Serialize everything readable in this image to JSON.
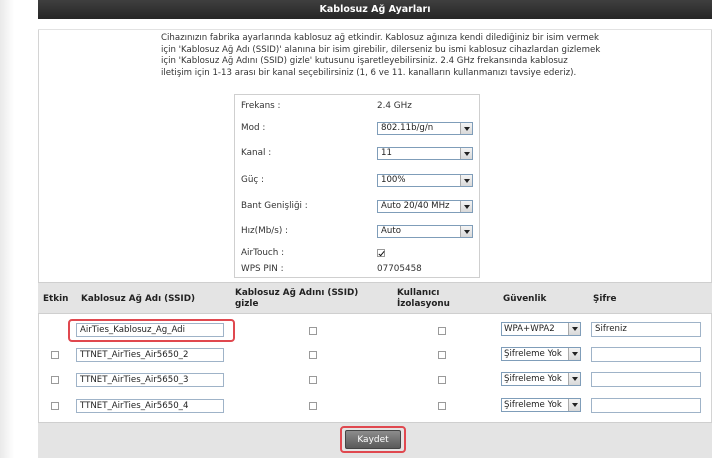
{
  "header": {
    "title": "Kablosuz Ağ Ayarları"
  },
  "description": "Cihazınızın fabrika ayarlarında kablosuz ağ etkindir. Kablosuz ağınıza kendi dilediğiniz bir isim vermek için 'Kablosuz Ağ Adı (SSID)' alanına bir isim girebilir, dilerseniz bu ismi kablosuz cihazlardan gizlemek için 'Kablosuz Ağ Adını (SSID) gizle' kutusunu işaretleyebilirsiniz. 2.4 GHz frekansında kablosuz iletişim için 1-13 arası bir kanal seçebilirsiniz (1, 6 ve 11. kanalların kullanmanızı tavsiye ederiz).",
  "settings": {
    "frekans_label": "Frekans :",
    "frekans_value": "2.4 GHz",
    "mod_label": "Mod :",
    "mod_value": "802.11b/g/n",
    "kanal_label": "Kanal :",
    "kanal_value": "11",
    "guc_label": "Güç :",
    "guc_value": "100%",
    "bant_label": "Bant Genişliği :",
    "bant_value": "Auto 20/40 MHz",
    "hiz_label": "Hız(Mb/s) :",
    "hiz_value": "Auto",
    "airtouch_label": "AirTouch :",
    "airtouch_checked": true,
    "wps_label": "WPS PIN :",
    "wps_value": "07705458"
  },
  "ssid_table": {
    "headers": {
      "etkin": "Etkin",
      "ssid": "Kablosuz Ağ Adı (SSID)",
      "gizle_line1": "Kablosuz Ağ Adını (SSID)",
      "gizle_line2": "gizle",
      "izolasyon_line1": "Kullanıcı",
      "izolasyon_line2": "İzolasyonu",
      "guvenlik": "Güvenlik",
      "sifre": "Şifre"
    },
    "rows": [
      {
        "ssid": "AirTies_Kablosuz_Ag_Adi",
        "security": "WPA+WPA2",
        "password": "Sifreniz"
      },
      {
        "ssid": "TTNET_AirTies_Air5650_2",
        "security": "Şifreleme Yok",
        "password": ""
      },
      {
        "ssid": "TTNET_AirTies_Air5650_3",
        "security": "Şifreleme Yok",
        "password": ""
      },
      {
        "ssid": "TTNET_AirTies_Air5650_4",
        "security": "Şifreleme Yok",
        "password": ""
      }
    ]
  },
  "footer": {
    "save_label": "Kaydet"
  },
  "colors": {
    "highlight": "#e0484f",
    "title_bar": "#2f2f2f",
    "header_bg": "#e4e4e4"
  }
}
